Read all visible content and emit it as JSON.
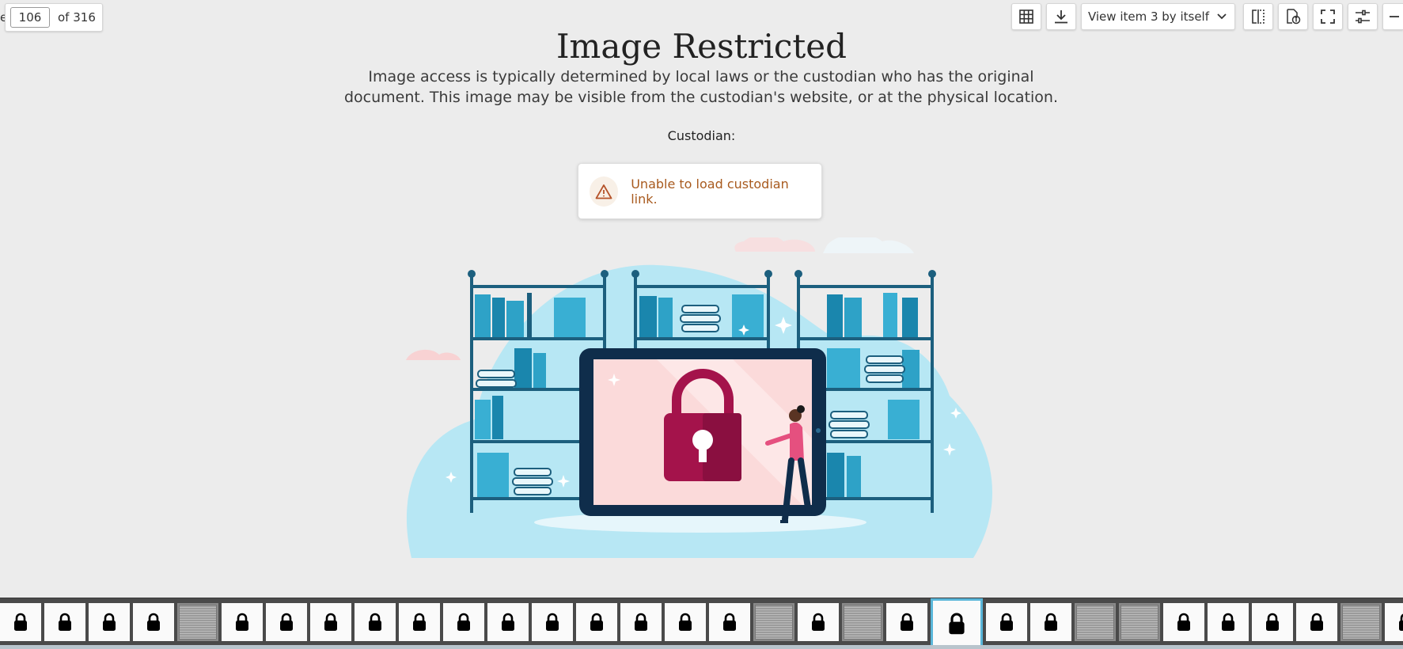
{
  "pager": {
    "prefix_cut": "e",
    "current": "106",
    "of_label": "of 316"
  },
  "toolbar": {
    "view_select_label": "View item 3 by itself",
    "buttons": [
      "grid-icon",
      "download-icon",
      "compare-icon",
      "info-icon",
      "fullscreen-icon",
      "sliders-icon",
      "minus-icon"
    ]
  },
  "content": {
    "title": "Image Restricted",
    "description_line1": "Image access is typically determined by local laws or the custodian who has the original",
    "description_line2": "document. This image may be visible from the custodian's website, or at the physical location.",
    "custodian_label": "Custodian:",
    "alert_text": "Unable to load custodian link."
  },
  "colors": {
    "accent": "#59b6d9",
    "alert_text": "#a85a1e",
    "lock": "#a4134b",
    "shelf": "#1c5f7e",
    "tablet": "#0f2d4b"
  },
  "filmstrip": {
    "thumbs": [
      "lock",
      "lock",
      "lock",
      "lock",
      "image",
      "lock",
      "lock",
      "lock",
      "lock",
      "lock",
      "lock",
      "lock",
      "lock",
      "lock",
      "lock",
      "lock",
      "lock",
      "image",
      "lock",
      "image",
      "lock",
      "lock-active",
      "lock",
      "lock",
      "image",
      "image",
      "lock",
      "lock",
      "lock",
      "lock",
      "image",
      "lock"
    ]
  }
}
